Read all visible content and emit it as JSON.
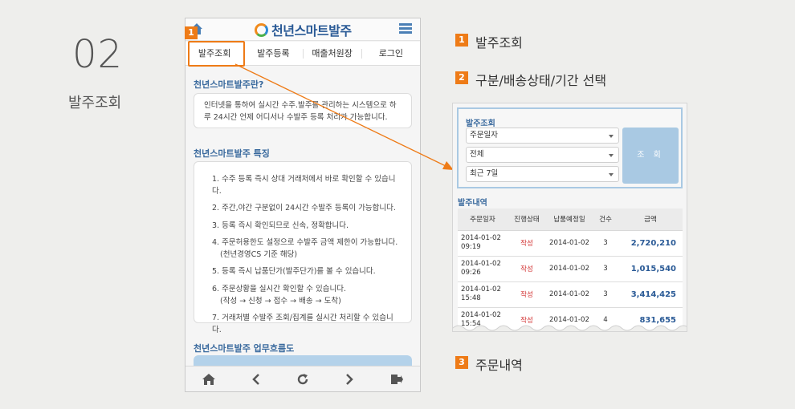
{
  "step": {
    "number": "02",
    "title": "발주조회"
  },
  "phone": {
    "brand": "천년스마트발주",
    "tabs": [
      "발주조회",
      "발주등록",
      "매출처원장",
      "로그인"
    ],
    "intro_title": "천년스마트발주란?",
    "intro_text": "인터넷을 통하여 실시간 수주.발주를 관리하는 시스템으로 하루 24시간 언제 어디서나 수발주 등록 처리가 가능합니다.",
    "features_title": "천년스마트발주 특징",
    "features": [
      "1. 수주 등록 즉시 상대 거래처에서 바로 확인할 수 있습니다.",
      "2. 주간,야간 구분없이 24시간 수발주 등록이 가능합니다.",
      "3. 등록 즉시 확인되므로 신속, 정확합니다.",
      "4. 주문허용한도 설정으로 수발주 금액 제한이 가능합니다.",
      "(천년경영CS 기준 해당)",
      "5. 등록 즉시 납품단가(발주단가)를 볼 수 있습니다.",
      "6. 주문상황을 실시간 확인할 수 있습니다.",
      "(작성 → 신청 → 접수 → 배송 → 도착)",
      "7. 거래처별 수발주 조회/집계를 실시간 처리할 수 있습니다."
    ],
    "flow_title": "천년스마트발주 업무흐름도",
    "footer_icons": [
      "home-icon",
      "back-icon",
      "refresh-icon",
      "forward-icon",
      "logout-icon"
    ]
  },
  "callouts": [
    {
      "num": "1",
      "text": "발주조회"
    },
    {
      "num": "2",
      "text": "구분/배송상태/기간 선택"
    },
    {
      "num": "3",
      "text": "주문내역"
    }
  ],
  "panel": {
    "search_title": "발주조회",
    "selects": [
      "주문일자",
      "전체",
      "최근 7일"
    ],
    "search_button": "조 회",
    "list_title": "발주내역",
    "columns": [
      "주문일자",
      "진행상태",
      "납품예정일",
      "건수",
      "금액"
    ],
    "rows": [
      {
        "date": "2014-01-02",
        "time": "09:19",
        "state": "작성",
        "due": "2014-01-02",
        "count": "3",
        "amount": "2,720,210"
      },
      {
        "date": "2014-01-02",
        "time": "09:26",
        "state": "작성",
        "due": "2014-01-02",
        "count": "3",
        "amount": "1,015,540"
      },
      {
        "date": "2014-01-02",
        "time": "15:48",
        "state": "작성",
        "due": "2014-01-02",
        "count": "3",
        "amount": "3,414,425"
      },
      {
        "date": "2014-01-02",
        "time": "15:54",
        "state": "작성",
        "due": "2014-01-02",
        "count": "4",
        "amount": "831,655"
      }
    ]
  },
  "colors": {
    "accent": "#ee7b17",
    "brand": "#2a5a96",
    "status_red": "#d23030"
  }
}
